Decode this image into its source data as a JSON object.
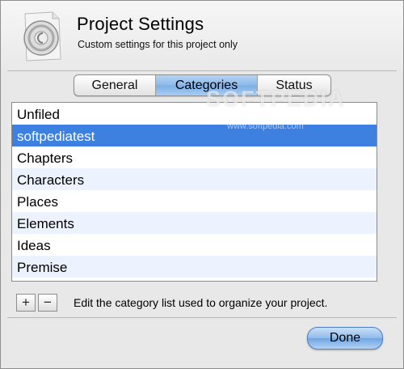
{
  "header": {
    "title": "Project Settings",
    "subtitle": "Custom settings for this project only"
  },
  "tabs": [
    {
      "label": "General",
      "selected": false
    },
    {
      "label": "Categories",
      "selected": true
    },
    {
      "label": "Status",
      "selected": false
    }
  ],
  "category_list": {
    "items": [
      {
        "label": "Unfiled",
        "selected": false
      },
      {
        "label": "softpediatest",
        "selected": true
      },
      {
        "label": "Chapters",
        "selected": false
      },
      {
        "label": "Characters",
        "selected": false
      },
      {
        "label": "Places",
        "selected": false
      },
      {
        "label": "Elements",
        "selected": false
      },
      {
        "label": "Ideas",
        "selected": false
      },
      {
        "label": "Premise",
        "selected": false
      }
    ]
  },
  "footer": {
    "add_label": "+",
    "remove_label": "−",
    "help_text": "Edit the category list used to organize your project.",
    "done_label": "Done"
  },
  "watermark": {
    "text": "SOFTPEDIA",
    "url": "www.softpedia.com"
  },
  "colors": {
    "selection": "#3d80df",
    "alt_row": "#edf3fe",
    "tab_active": "#8bb8ea"
  }
}
